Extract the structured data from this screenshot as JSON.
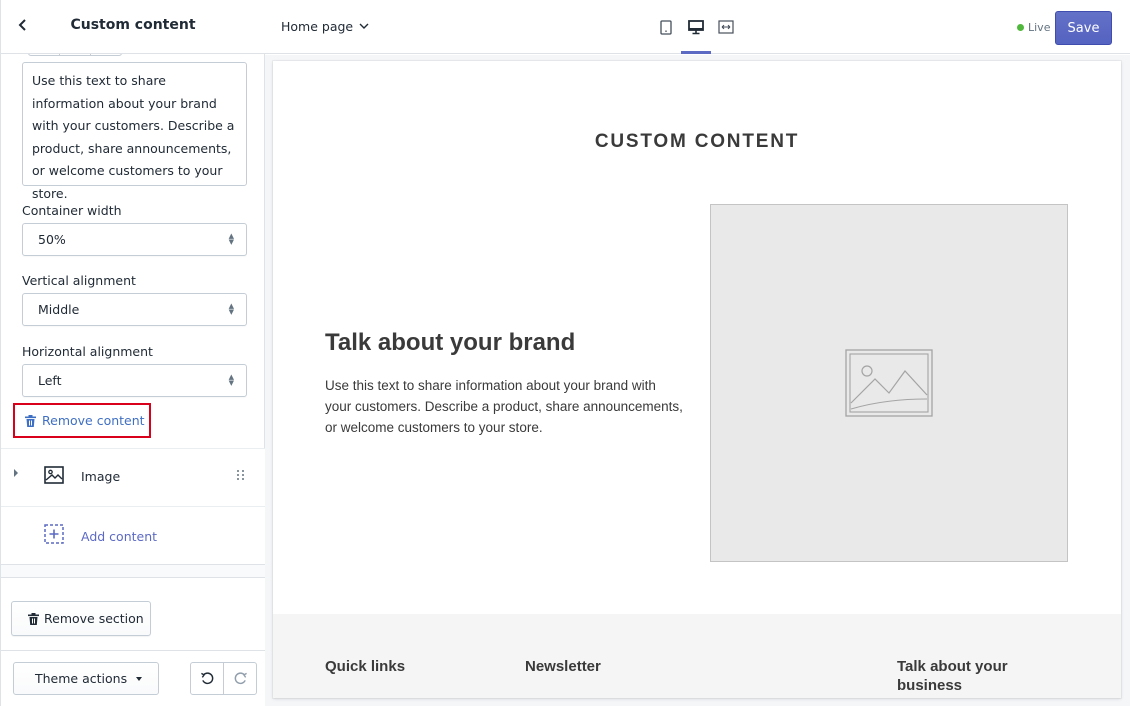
{
  "sidebar": {
    "title": "Custom content",
    "back_icon": "chevron-left-icon",
    "richtext": "Use this text to share information about your brand with your customers. Describe a product, share announcements, or welcome customers to your store.",
    "fields": {
      "container_width": {
        "label": "Container width",
        "value": "50%"
      },
      "vertical_alignment": {
        "label": "Vertical alignment",
        "value": "Middle"
      },
      "horizontal_alignment": {
        "label": "Horizontal alignment",
        "value": "Left"
      }
    },
    "remove_content_label": "Remove content",
    "blocks": [
      {
        "label": "Image",
        "icon": "image-icon"
      }
    ],
    "add_content_label": "Add content",
    "remove_section_label": "Remove section",
    "theme_actions_label": "Theme actions"
  },
  "topbar": {
    "page_label": "Home page",
    "devices": [
      "mobile-icon",
      "desktop-icon",
      "fullscreen-icon"
    ],
    "active_device": "desktop-icon",
    "live_label": "Live",
    "save_label": "Save"
  },
  "preview": {
    "section_title": "CUSTOM CONTENT",
    "heading": "Talk about your brand",
    "body": "Use this text to share information about your brand with your customers. Describe a product, share announcements, or welcome customers to your store.",
    "footer": {
      "col1": "Quick links",
      "col2": "Newsletter",
      "col3": "Talk about your business"
    }
  },
  "colors": {
    "accent": "#5c6ac4",
    "link": "#3f6fc3",
    "highlight_border": "#d9001b",
    "live": "#50b83c"
  }
}
